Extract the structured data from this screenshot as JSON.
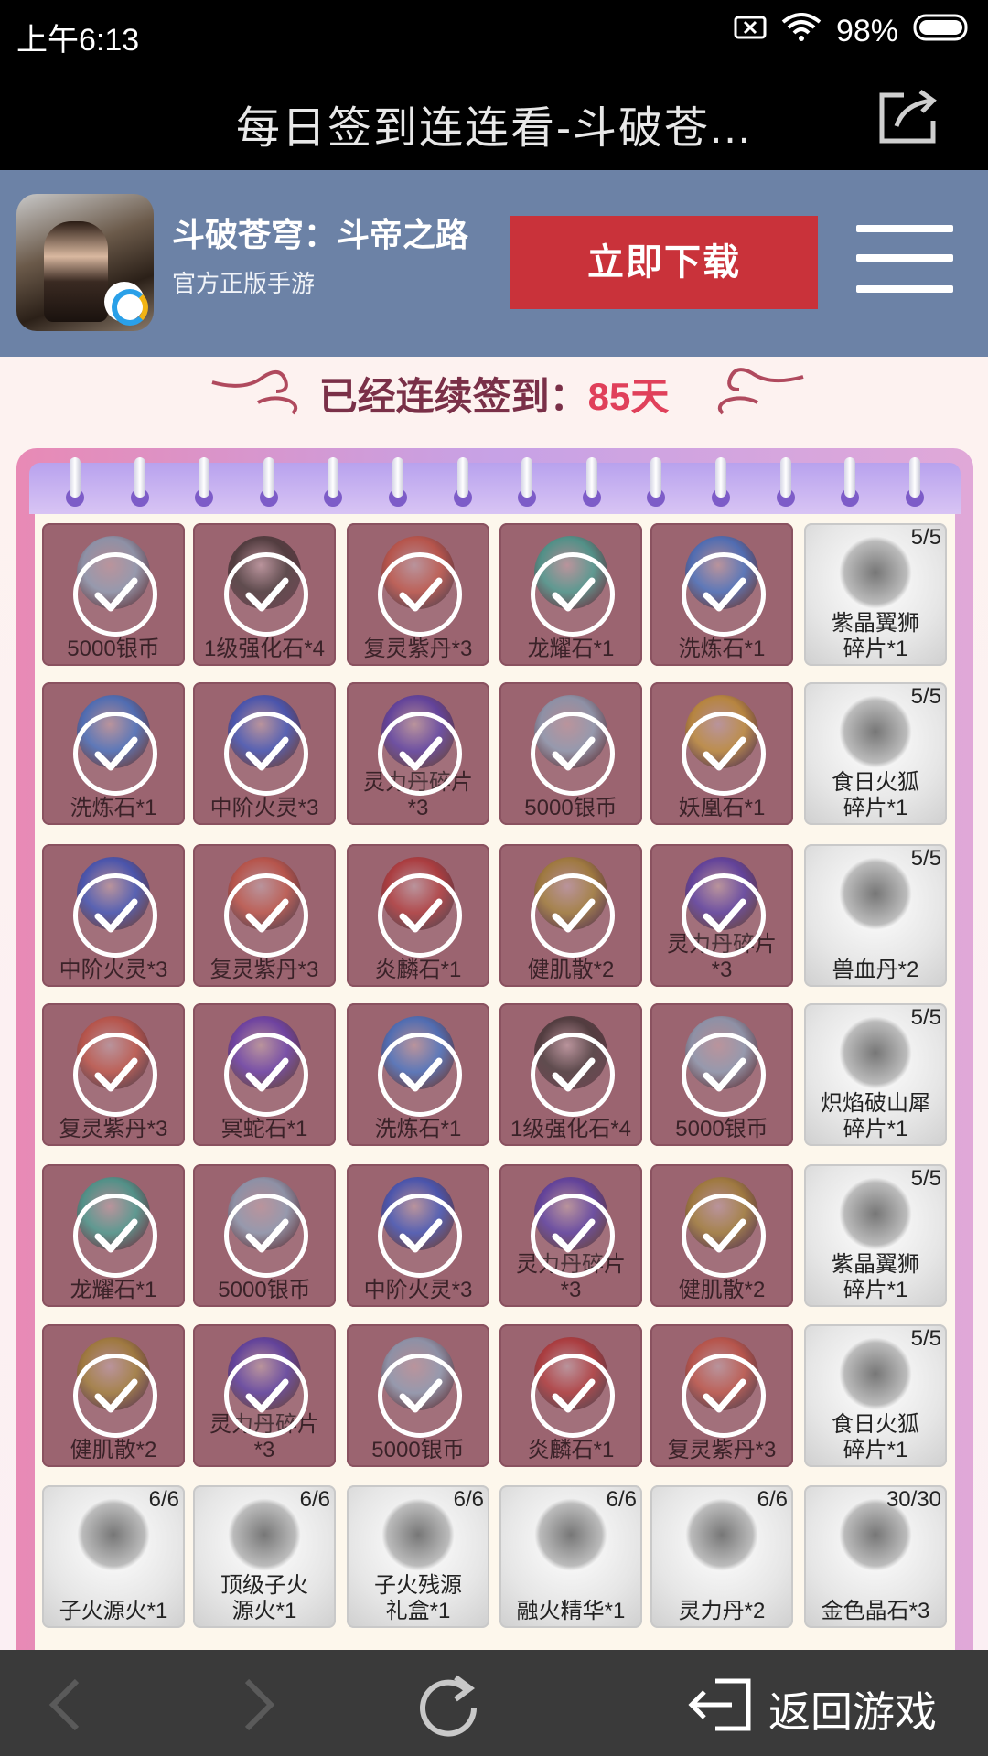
{
  "status_bar": {
    "time": "上午6:13",
    "battery_percent": "98%"
  },
  "title_bar": {
    "title": "每日签到连连看-斗破苍..."
  },
  "banner": {
    "app_name": "斗破苍穹：斗帝之路",
    "app_subtitle": "官方正版手游",
    "download_label": "立即下载",
    "button_color": "#c9323a",
    "background_color": "#6c82a6"
  },
  "streak": {
    "label": "已经连续签到：",
    "value": "85天"
  },
  "grid": {
    "rows": [
      [
        {
          "label": "5000银币",
          "done": true,
          "color": "#8aa0b8"
        },
        {
          "label": "1级强化石*4",
          "done": true,
          "color": "#3a3030"
        },
        {
          "label": "复灵紫丹*3",
          "done": true,
          "color": "#c05040"
        },
        {
          "label": "龙耀石*1",
          "done": true,
          "color": "#3aa090"
        },
        {
          "label": "洗炼石*1",
          "done": true,
          "color": "#3870c8"
        },
        {
          "label": "紫晶翼狮\n碎片*1",
          "done": false,
          "count": "5/5"
        }
      ],
      [
        {
          "label": "洗炼石*1",
          "done": true,
          "color": "#3870c8"
        },
        {
          "label": "中阶火灵*3",
          "done": true,
          "color": "#3050c0"
        },
        {
          "label": "灵力丹碎片\n*3",
          "done": true,
          "color": "#5038a8"
        },
        {
          "label": "5000银币",
          "done": true,
          "color": "#8aa0b8"
        },
        {
          "label": "妖凰石*1",
          "done": true,
          "color": "#c09030"
        },
        {
          "label": "食日火狐\n碎片*1",
          "done": false,
          "count": "5/5"
        }
      ],
      [
        {
          "label": "中阶火灵*3",
          "done": true,
          "color": "#3050c0"
        },
        {
          "label": "复灵紫丹*3",
          "done": true,
          "color": "#c05040"
        },
        {
          "label": "炎麟石*1",
          "done": true,
          "color": "#b03030"
        },
        {
          "label": "健肌散*2",
          "done": true,
          "color": "#a08030"
        },
        {
          "label": "灵力丹碎片\n*3",
          "done": true,
          "color": "#5038a8"
        },
        {
          "label": "兽血丹*2",
          "done": false,
          "count": "5/5"
        }
      ],
      [
        {
          "label": "复灵紫丹*3",
          "done": true,
          "color": "#c05040"
        },
        {
          "label": "冥蛇石*1",
          "done": true,
          "color": "#6038b0"
        },
        {
          "label": "洗炼石*1",
          "done": true,
          "color": "#3870c8"
        },
        {
          "label": "1级强化石*4",
          "done": true,
          "color": "#3a3030"
        },
        {
          "label": "5000银币",
          "done": true,
          "color": "#8aa0b8"
        },
        {
          "label": "炽焰破山犀\n碎片*1",
          "done": false,
          "count": "5/5"
        }
      ],
      [
        {
          "label": "龙耀石*1",
          "done": true,
          "color": "#3aa090"
        },
        {
          "label": "5000银币",
          "done": true,
          "color": "#8aa0b8"
        },
        {
          "label": "中阶火灵*3",
          "done": true,
          "color": "#3050c0"
        },
        {
          "label": "灵力丹碎片\n*3",
          "done": true,
          "color": "#5038a8"
        },
        {
          "label": "健肌散*2",
          "done": true,
          "color": "#a08030"
        },
        {
          "label": "紫晶翼狮\n碎片*1",
          "done": false,
          "count": "5/5"
        }
      ],
      [
        {
          "label": "健肌散*2",
          "done": true,
          "color": "#a08030"
        },
        {
          "label": "灵力丹碎片\n*3",
          "done": true,
          "color": "#5038a8"
        },
        {
          "label": "5000银币",
          "done": true,
          "color": "#8aa0b8"
        },
        {
          "label": "炎麟石*1",
          "done": true,
          "color": "#b03030"
        },
        {
          "label": "复灵紫丹*3",
          "done": true,
          "color": "#c05040"
        },
        {
          "label": "食日火狐\n碎片*1",
          "done": false,
          "count": "5/5"
        }
      ],
      [
        {
          "label": "子火源火*1",
          "done": false,
          "count": "6/6"
        },
        {
          "label": "顶级子火\n源火*1",
          "done": false,
          "count": "6/6"
        },
        {
          "label": "子火残源\n礼盒*1",
          "done": false,
          "count": "6/6"
        },
        {
          "label": "融火精华*1",
          "done": false,
          "count": "6/6"
        },
        {
          "label": "灵力丹*2",
          "done": false,
          "count": "6/6"
        },
        {
          "label": "金色晶石*3",
          "done": false,
          "count": "30/30"
        }
      ]
    ]
  },
  "bottom_nav": {
    "return_label": "返回游戏"
  }
}
